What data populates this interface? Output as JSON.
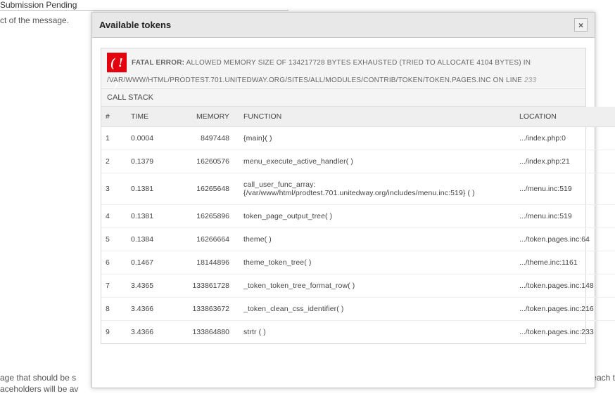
{
  "background": {
    "field_label": "Submission Pending",
    "help": "ct of the message.",
    "bottom1": "age that should be s",
    "bottom2": "aceholders will be av",
    "right1": "ent each t"
  },
  "modal": {
    "title": "Available tokens",
    "close_label": "×"
  },
  "error": {
    "icon": "( ! )",
    "prefix": "FATAL ERROR:",
    "message": " ALLOWED MEMORY SIZE OF 134217728 BYTES EXHAUSTED (TRIED TO ALLOCATE 4104 BYTES) IN ",
    "path": "/VAR/WWW/HTML/PRODTEST.701.UNITEDWAY.ORG/SITES/ALL/MODULES/CONTRIB/TOKEN/TOKEN.PAGES.INC",
    "on_line": " ON LINE ",
    "line": "233"
  },
  "stack": {
    "caption": "CALL STACK",
    "headers": {
      "num": "#",
      "time": "TIME",
      "memory": "MEMORY",
      "func": "FUNCTION",
      "loc": "LOCATION"
    },
    "rows": [
      {
        "num": "1",
        "time": "0.0004",
        "memory": "8497448",
        "func": "{main}( )",
        "loc": ".../index.php:0"
      },
      {
        "num": "2",
        "time": "0.1379",
        "memory": "16260576",
        "func": "menu_execute_active_handler( )",
        "loc": ".../index.php:21"
      },
      {
        "num": "3",
        "time": "0.1381",
        "memory": "16265648",
        "func": "call_user_func_array: {/var/www/html/prodtest.701.unitedway.org/includes/menu.inc:519} ( )",
        "loc": ".../menu.inc:519"
      },
      {
        "num": "4",
        "time": "0.1381",
        "memory": "16265896",
        "func": "token_page_output_tree( )",
        "loc": ".../menu.inc:519"
      },
      {
        "num": "5",
        "time": "0.1384",
        "memory": "16266664",
        "func": "theme( )",
        "loc": ".../token.pages.inc:64"
      },
      {
        "num": "6",
        "time": "0.1467",
        "memory": "18144896",
        "func": "theme_token_tree( )",
        "loc": ".../theme.inc:1161"
      },
      {
        "num": "7",
        "time": "3.4365",
        "memory": "133861728",
        "func": "_token_token_tree_format_row( )",
        "loc": ".../token.pages.inc:148"
      },
      {
        "num": "8",
        "time": "3.4366",
        "memory": "133863672",
        "func": "_token_clean_css_identifier( )",
        "loc": ".../token.pages.inc:216"
      },
      {
        "num": "9",
        "time": "3.4366",
        "memory": "133864880",
        "func": "strtr ( )",
        "loc": ".../token.pages.inc:233"
      }
    ]
  }
}
